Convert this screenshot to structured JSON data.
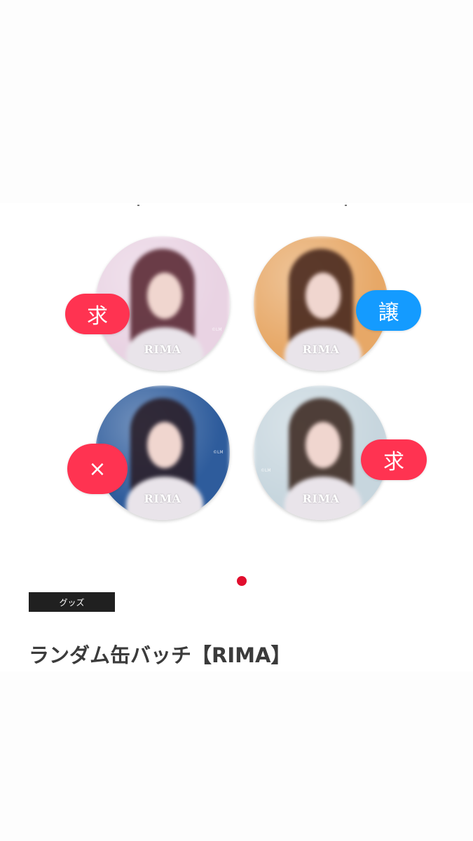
{
  "product": {
    "category": "グッズ",
    "title": "ランダム缶バッチ【RIMA】"
  },
  "badges": [
    {
      "name": "RIMA",
      "copyright": "©LM",
      "background": "#e9d3e3",
      "hair": "#5b2a35",
      "status": "求",
      "status_color": "#ff3351"
    },
    {
      "name": "RIMA",
      "copyright": "",
      "background": "#e7a867",
      "hair": "#4a2a1f",
      "status": "譲",
      "status_color": "#149bff"
    },
    {
      "name": "RIMA",
      "copyright": "©LM",
      "background": "#2e5c9c",
      "hair": "#2a1f2a",
      "status": "×",
      "status_color": "#ff3351"
    },
    {
      "name": "RIMA",
      "copyright": "©LM",
      "background": "#c7d6de",
      "hair": "#3f2c25",
      "status": "求",
      "status_color": "#ff3351"
    }
  ],
  "carousel": {
    "current_page": 1,
    "total_pages": 1,
    "indicator_color": "#e10e2e"
  }
}
